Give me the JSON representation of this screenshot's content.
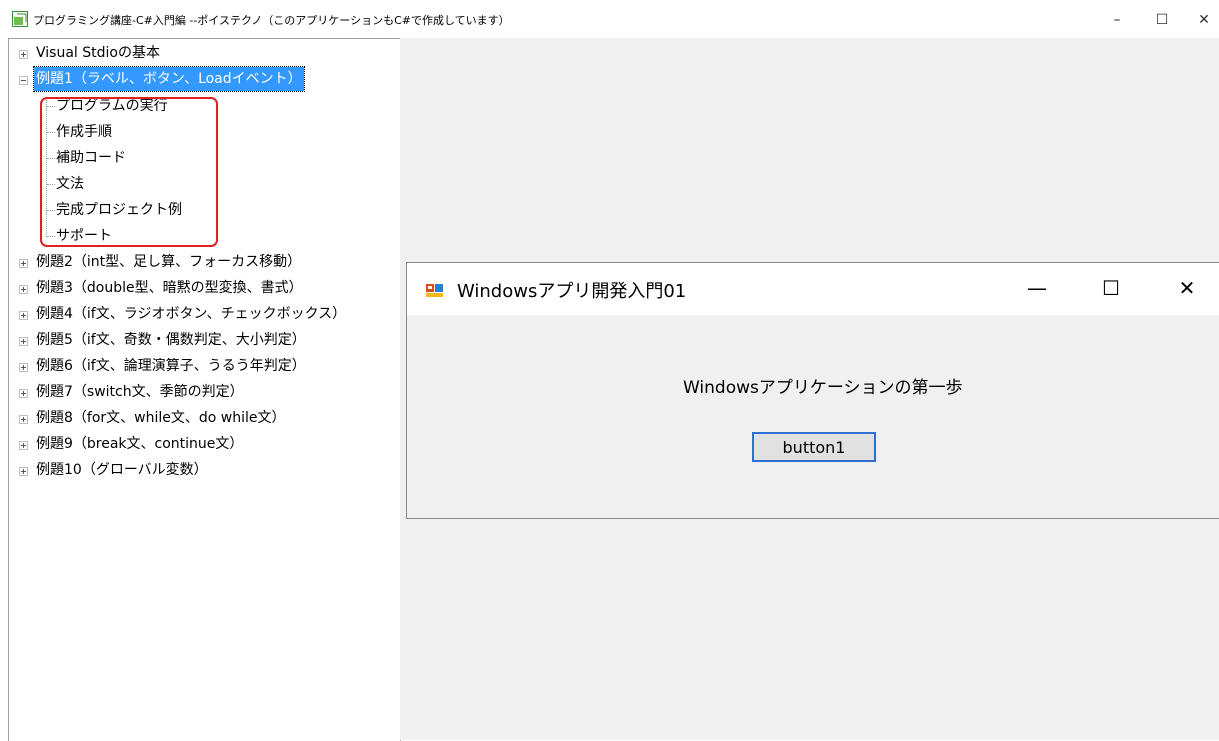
{
  "window": {
    "title": "プログラミング講座-C#入門編 --ポイステクノ（このアプリケーションもC#で作成しています）",
    "controls": {
      "minimize": "–",
      "maximize": "☐",
      "close": "✕"
    }
  },
  "tree": {
    "nodes": [
      {
        "label": "Visual Stdioの基本",
        "expanded": false
      },
      {
        "label": "例題1（ラベル、ボタン、Loadイベント）",
        "expanded": true,
        "selected": true,
        "children": [
          "プログラムの実行",
          "作成手順",
          "補助コード",
          "文法",
          "完成プロジェクト例",
          "サポート"
        ]
      },
      {
        "label": "例題2（int型、足し算、フォーカス移動）",
        "expanded": false
      },
      {
        "label": "例題3（double型、暗黙の型変換、書式）",
        "expanded": false
      },
      {
        "label": "例題4（if文、ラジオボタン、チェックボックス）",
        "expanded": false
      },
      {
        "label": "例題5（if文、奇数・偶数判定、大小判定）",
        "expanded": false
      },
      {
        "label": "例題6（if文、論理演算子、うるう年判定）",
        "expanded": false
      },
      {
        "label": "例題7（switch文、季節の判定）",
        "expanded": false
      },
      {
        "label": "例題8（for文、while文、do while文）",
        "expanded": false
      },
      {
        "label": "例題9（break文、continue文）",
        "expanded": false
      },
      {
        "label": "例題10（グローバル変数）",
        "expanded": false
      }
    ]
  },
  "form": {
    "title": "Windowsアプリ開発入門01",
    "controls": {
      "minimize": "—",
      "maximize": "☐",
      "close": "✕"
    },
    "label": "Windowsアプリケーションの第一歩",
    "button": "button1"
  },
  "colors": {
    "selection": "#3399ff",
    "highlight_border": "#e02020",
    "button_focus": "#2f6fd0"
  }
}
